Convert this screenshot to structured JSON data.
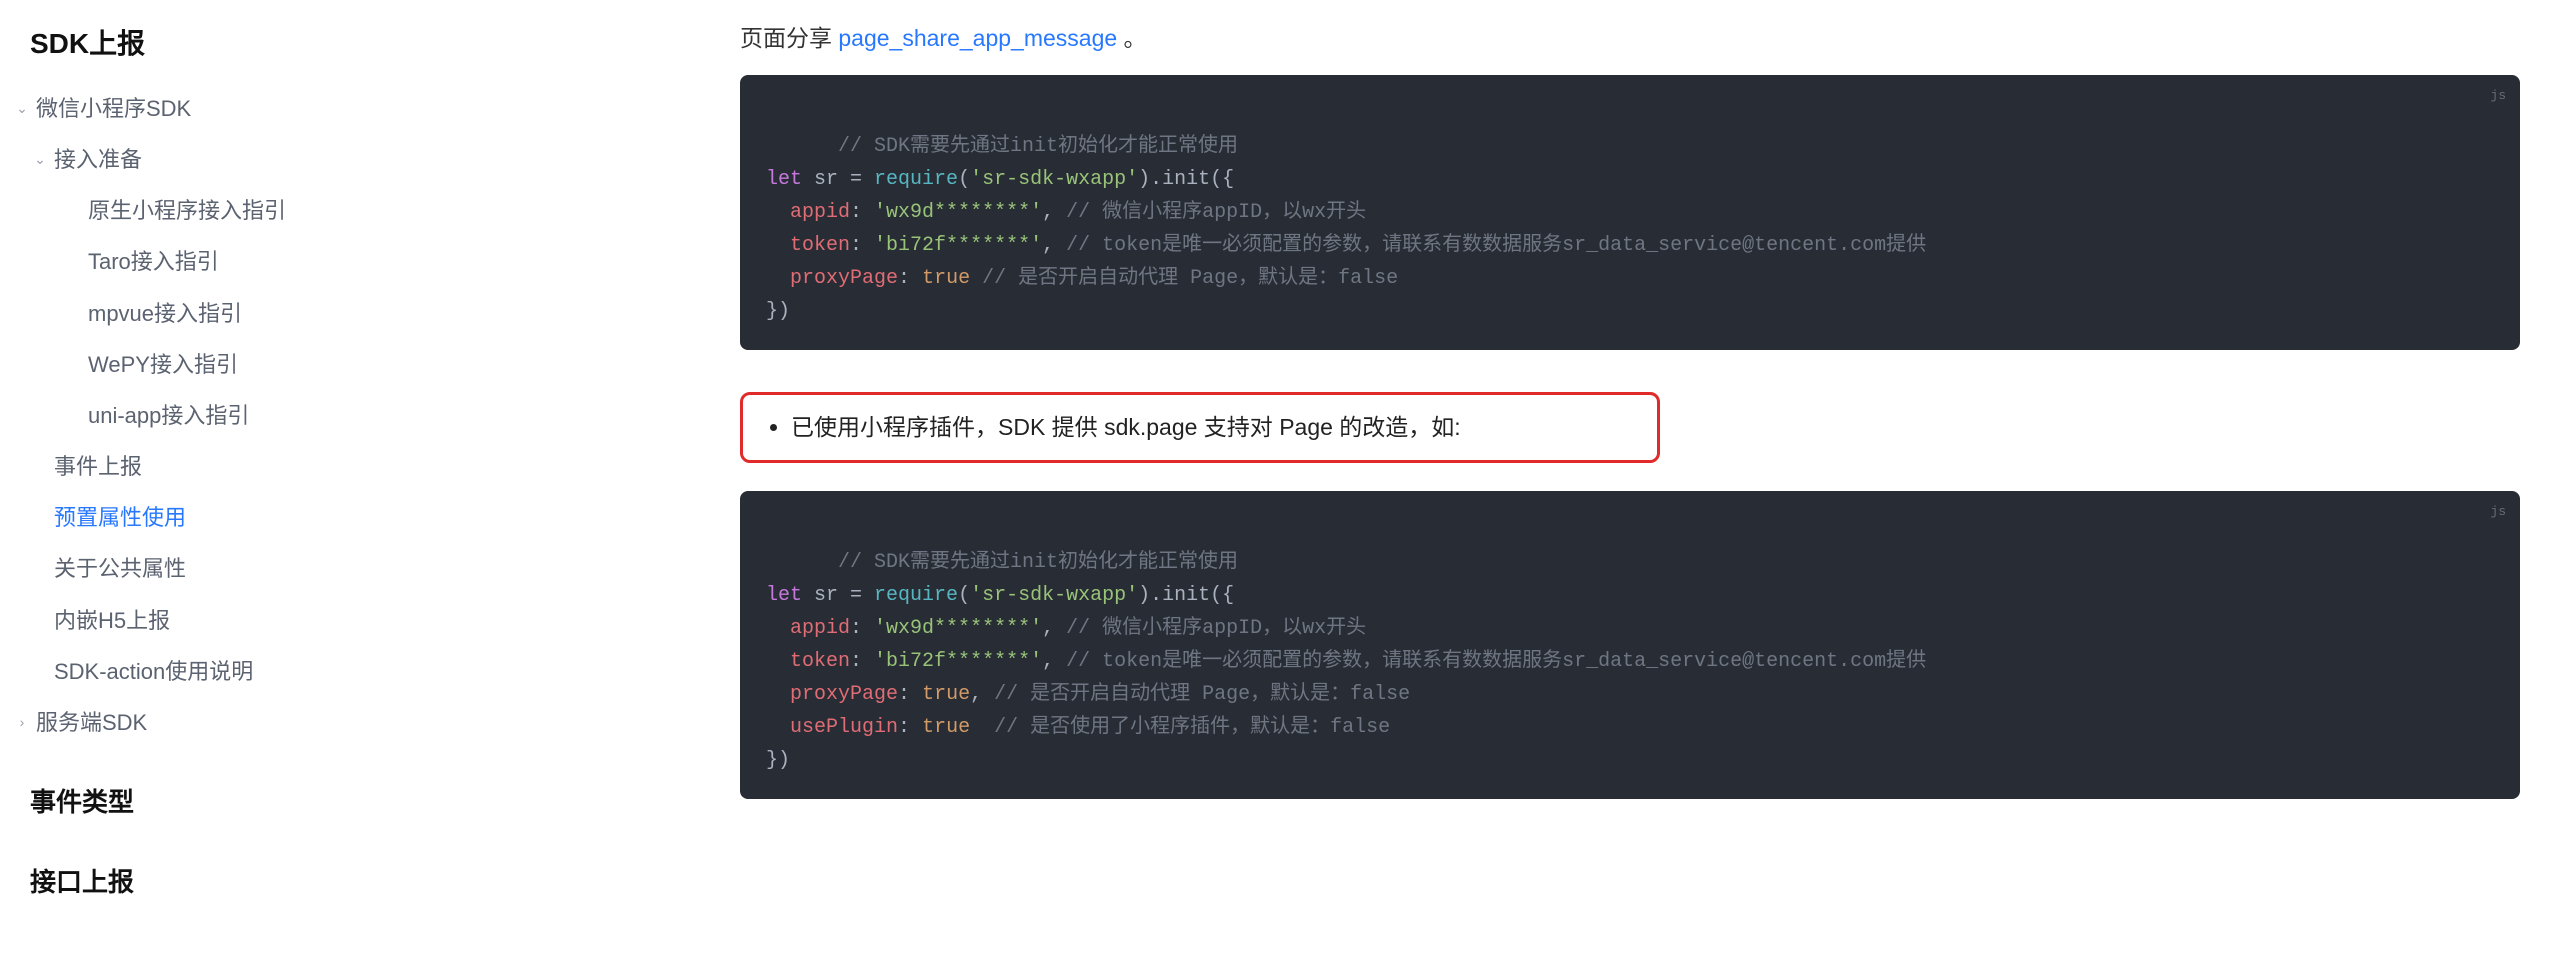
{
  "sidebar": {
    "title": "SDK上报",
    "items": [
      {
        "label": "微信小程序SDK",
        "level": 0,
        "expanded": true,
        "hasChildren": true
      },
      {
        "label": "接入准备",
        "level": 1,
        "expanded": true,
        "hasChildren": true
      },
      {
        "label": "原生小程序接入指引",
        "level": 2,
        "expanded": false,
        "hasChildren": false
      },
      {
        "label": "Taro接入指引",
        "level": 2,
        "expanded": false,
        "hasChildren": false
      },
      {
        "label": "mpvue接入指引",
        "level": 2,
        "expanded": false,
        "hasChildren": false
      },
      {
        "label": "WePY接入指引",
        "level": 2,
        "expanded": false,
        "hasChildren": false
      },
      {
        "label": "uni-app接入指引",
        "level": 2,
        "expanded": false,
        "hasChildren": false
      },
      {
        "label": "事件上报",
        "level": 1,
        "expanded": false,
        "hasChildren": false
      },
      {
        "label": "预置属性使用",
        "level": 1,
        "expanded": false,
        "hasChildren": false,
        "active": true
      },
      {
        "label": "关于公共属性",
        "level": 1,
        "expanded": false,
        "hasChildren": false
      },
      {
        "label": "内嵌H5上报",
        "level": 1,
        "expanded": false,
        "hasChildren": false
      },
      {
        "label": "SDK-action使用说明",
        "level": 1,
        "expanded": false,
        "hasChildren": false
      },
      {
        "label": "服务端SDK",
        "level": 0,
        "expanded": false,
        "hasChildren": true
      }
    ],
    "headings": [
      "事件类型",
      "接口上报"
    ]
  },
  "content": {
    "intro_prefix": "页面分享 ",
    "intro_link": "page_share_app_message",
    "intro_suffix": " 。",
    "code_lang": "js",
    "code1": {
      "c1": "// SDK需要先通过init初始化才能正常使用",
      "kw_let": "let",
      "var_sr": " sr ",
      "eq": "= ",
      "fn_require": "require",
      "p_open": "(",
      "str_pkg": "'sr-sdk-wxapp'",
      "p_close": ")",
      "dot_init": ".init({",
      "prop_appid": "appid",
      "colon": ": ",
      "str_appid": "'wx9d********'",
      "comma": ", ",
      "c_appid": "// 微信小程序appID，以wx开头",
      "prop_token": "token",
      "str_token": "'bi72f*******'",
      "c_token": "// token是唯一必须配置的参数，请联系有数数据服务sr_data_service@tencent.com提供",
      "prop_proxy": "proxyPage",
      "bool_true": "true",
      "c_proxy": " // 是否开启自动代理 Page，默认是：false",
      "close": "})"
    },
    "callout": "已使用小程序插件，SDK 提供 sdk.page 支持对 Page 的改造，如:",
    "code2": {
      "c1": "// SDK需要先通过init初始化才能正常使用",
      "kw_let": "let",
      "var_sr": " sr ",
      "eq": "= ",
      "fn_require": "require",
      "p_open": "(",
      "str_pkg": "'sr-sdk-wxapp'",
      "p_close": ")",
      "dot_init": ".init({",
      "prop_appid": "appid",
      "colon": ": ",
      "str_appid": "'wx9d********'",
      "comma": ", ",
      "c_appid": "// 微信小程序appID，以wx开头",
      "prop_token": "token",
      "str_token": "'bi72f*******'",
      "c_token": "// token是唯一必须配置的参数，请联系有数数据服务sr_data_service@tencent.com提供",
      "prop_proxy": "proxyPage",
      "bool_true": "true",
      "c_proxy": "// 是否开启自动代理 Page，默认是：false",
      "prop_useplugin": "usePlugin",
      "c_useplugin": "// 是否使用了小程序插件，默认是：false",
      "close": "})"
    }
  }
}
